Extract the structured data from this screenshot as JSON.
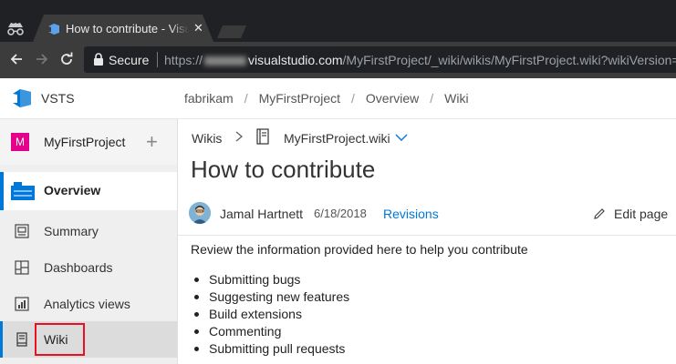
{
  "browser": {
    "tab_title": "How to contribute - Visual Studio",
    "tab_close": "✕",
    "secure_label": "Secure",
    "url_scheme": "https://",
    "url_host": "visualstudio.com",
    "url_path": "/MyFirstProject/_wiki/wikis/MyFirstProject.wiki?wikiVersion="
  },
  "header": {
    "brand": "VSTS",
    "breadcrumbs": [
      "fabrikam",
      "MyFirstProject",
      "Overview",
      "Wiki"
    ]
  },
  "sidebar": {
    "project_initial": "M",
    "project_name": "MyFirstProject",
    "add_symbol": "+",
    "items": [
      {
        "label": "Overview",
        "icon": "overview-icon"
      },
      {
        "label": "Summary",
        "icon": "summary-icon"
      },
      {
        "label": "Dashboards",
        "icon": "dashboards-icon"
      },
      {
        "label": "Analytics views",
        "icon": "analytics-icon"
      },
      {
        "label": "Wiki",
        "icon": "wiki-icon"
      }
    ],
    "selected": "Wiki",
    "accent_color": "#0078d7",
    "project_color": "#e3008c",
    "highlight_color": "#e81123"
  },
  "main": {
    "wikis_label": "Wikis",
    "wiki_name": "MyFirstProject.wiki",
    "page_title": "How to contribute",
    "author": "Jamal Hartnett",
    "date": "6/18/2018",
    "revisions_label": "Revisions",
    "edit_label": "Edit page",
    "intro": "Review the information provided here to help you contribute",
    "bullets": [
      "Submitting bugs",
      "Suggesting new features",
      "Build extensions",
      "Commenting",
      "Submitting pull requests"
    ]
  }
}
